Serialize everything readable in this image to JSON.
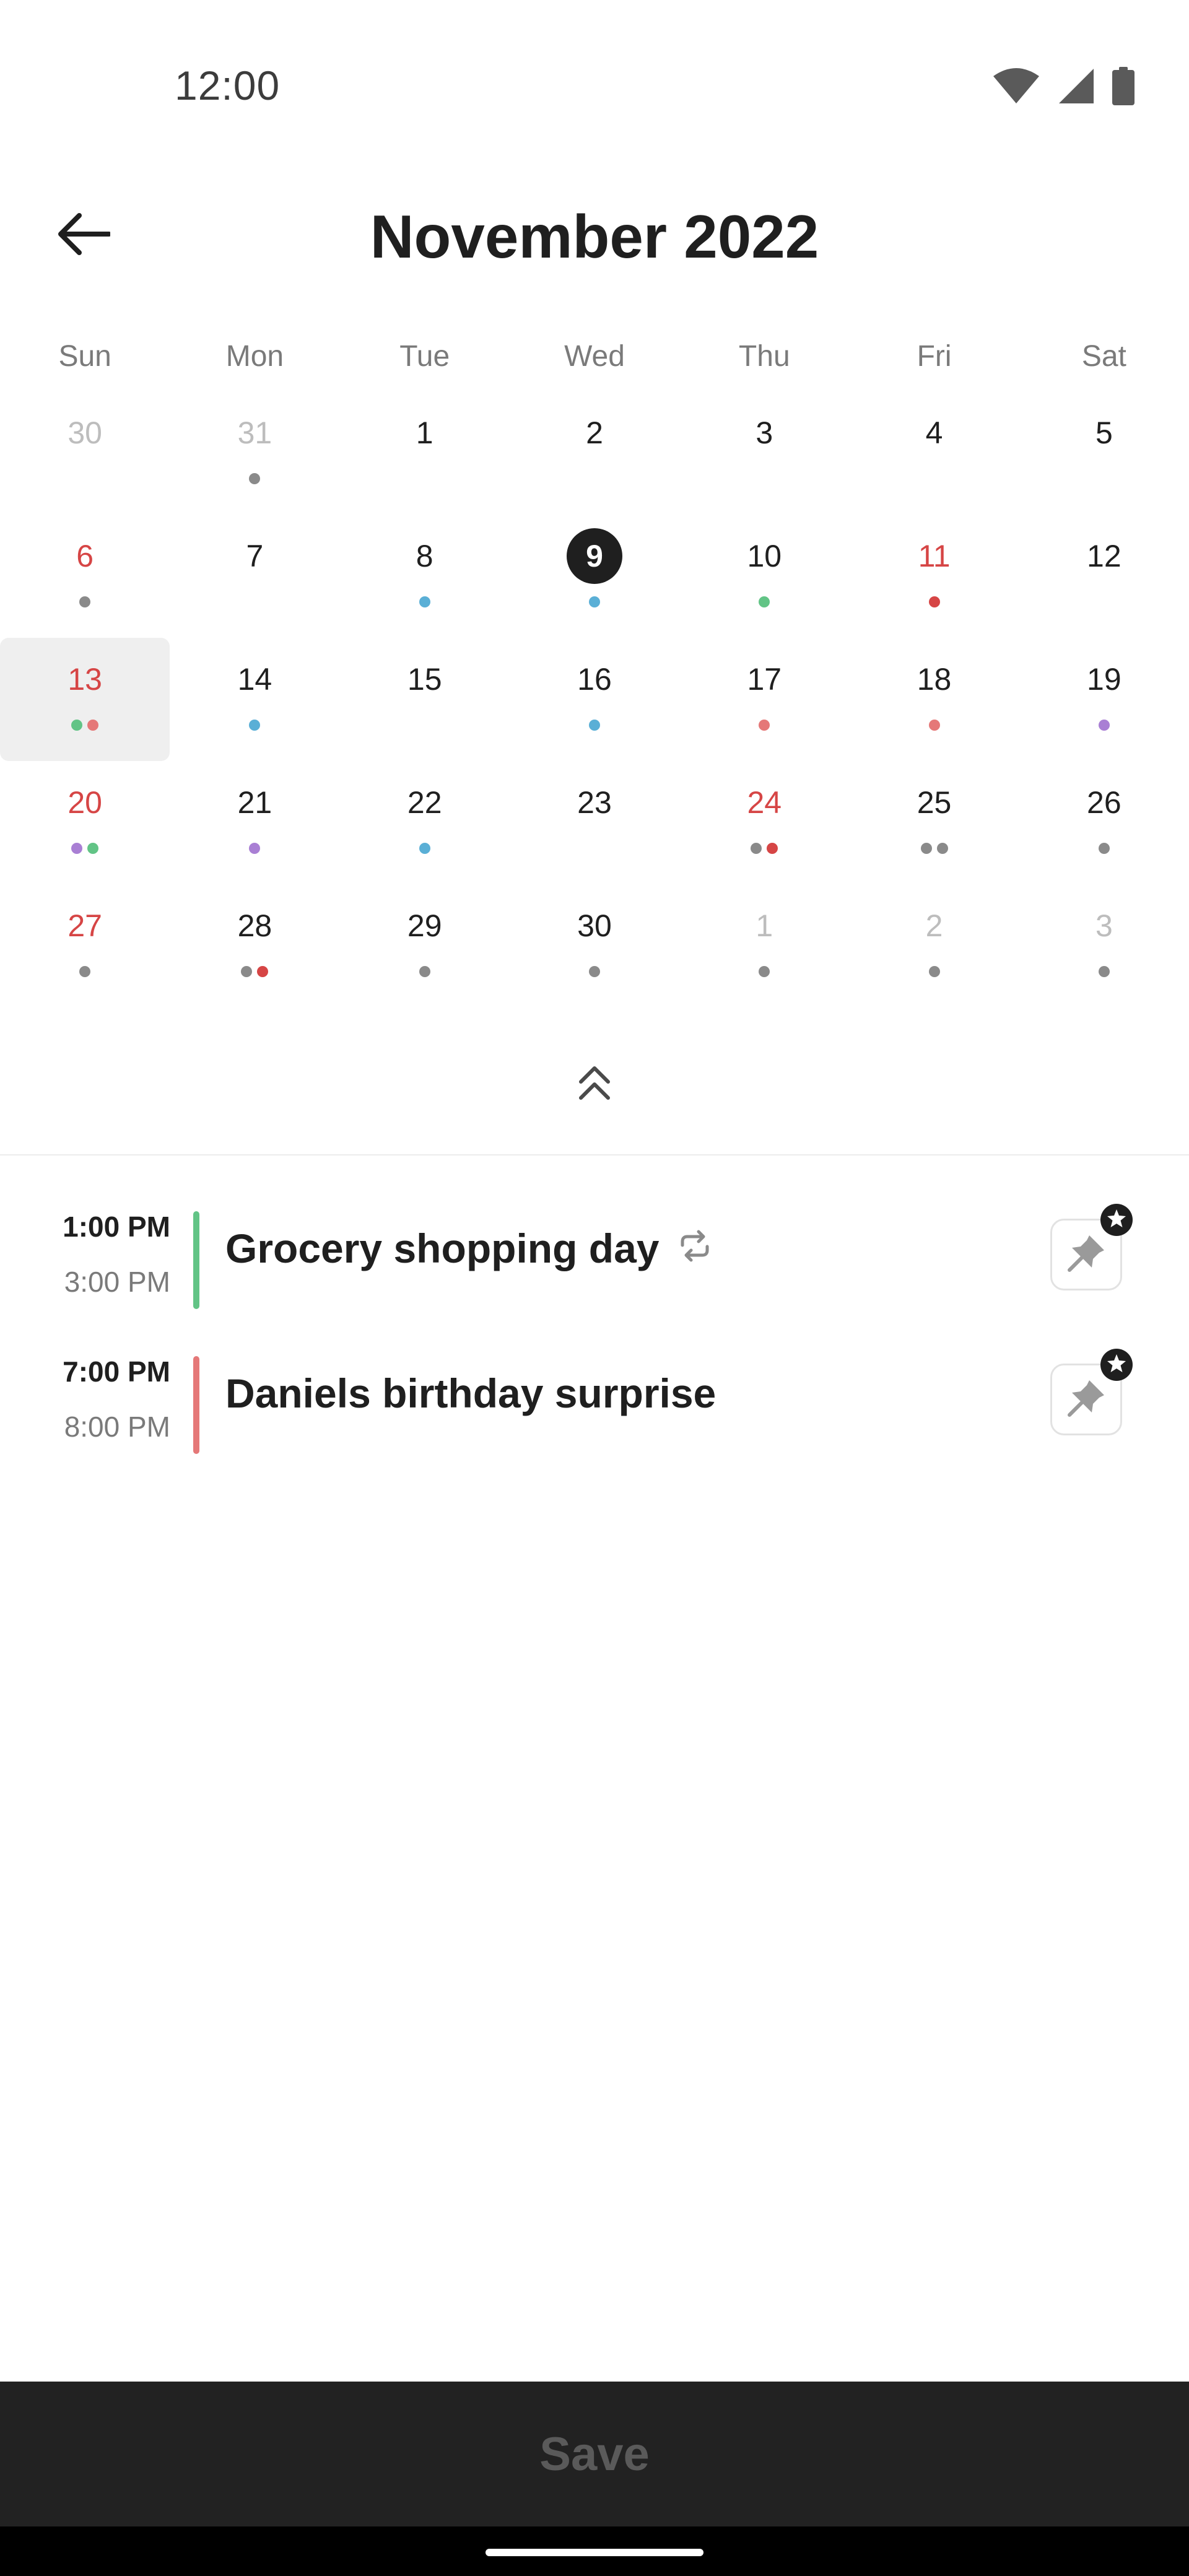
{
  "status_bar": {
    "time": "12:00",
    "icons": [
      "wifi-icon",
      "cellular-signal-icon",
      "battery-icon"
    ]
  },
  "header": {
    "title": "November 2022",
    "back_icon": "arrow-left-icon"
  },
  "calendar": {
    "weekdays": [
      "Sun",
      "Mon",
      "Tue",
      "Wed",
      "Thu",
      "Fri",
      "Sat"
    ],
    "days": [
      {
        "label": "30",
        "style": "muted",
        "dots": []
      },
      {
        "label": "31",
        "style": "muted",
        "dots": [
          "#8a8a8a"
        ]
      },
      {
        "label": "1",
        "style": "normal",
        "dots": []
      },
      {
        "label": "2",
        "style": "normal",
        "dots": []
      },
      {
        "label": "3",
        "style": "normal",
        "dots": []
      },
      {
        "label": "4",
        "style": "normal",
        "dots": []
      },
      {
        "label": "5",
        "style": "normal",
        "dots": []
      },
      {
        "label": "6",
        "style": "weekend",
        "dots": [
          "#8a8a8a"
        ]
      },
      {
        "label": "7",
        "style": "normal",
        "dots": []
      },
      {
        "label": "8",
        "style": "normal",
        "dots": [
          "#5aafd6"
        ]
      },
      {
        "label": "9",
        "style": "today",
        "dots": [
          "#5aafd6"
        ]
      },
      {
        "label": "10",
        "style": "normal",
        "dots": [
          "#62c486"
        ]
      },
      {
        "label": "11",
        "style": "weekend",
        "dots": [
          "#d64545"
        ]
      },
      {
        "label": "12",
        "style": "normal",
        "dots": []
      },
      {
        "label": "13",
        "style": "weekend",
        "highlighted": true,
        "dots": [
          "#62c486",
          "#e57878"
        ]
      },
      {
        "label": "14",
        "style": "normal",
        "dots": [
          "#5aafd6"
        ]
      },
      {
        "label": "15",
        "style": "normal",
        "dots": []
      },
      {
        "label": "16",
        "style": "normal",
        "dots": [
          "#5aafd6"
        ]
      },
      {
        "label": "17",
        "style": "normal",
        "dots": [
          "#e57878"
        ]
      },
      {
        "label": "18",
        "style": "normal",
        "dots": [
          "#e57878"
        ]
      },
      {
        "label": "19",
        "style": "normal",
        "dots": [
          "#a97fd4"
        ]
      },
      {
        "label": "20",
        "style": "weekend",
        "dots": [
          "#a97fd4",
          "#62c486"
        ]
      },
      {
        "label": "21",
        "style": "normal",
        "dots": [
          "#a97fd4"
        ]
      },
      {
        "label": "22",
        "style": "normal",
        "dots": [
          "#5aafd6"
        ]
      },
      {
        "label": "23",
        "style": "normal",
        "dots": []
      },
      {
        "label": "24",
        "style": "weekend",
        "dots": [
          "#8a8a8a",
          "#d64545"
        ]
      },
      {
        "label": "25",
        "style": "normal",
        "dots": [
          "#8a8a8a",
          "#8a8a8a"
        ]
      },
      {
        "label": "26",
        "style": "normal",
        "dots": [
          "#8a8a8a"
        ]
      },
      {
        "label": "27",
        "style": "weekend",
        "dots": [
          "#8a8a8a"
        ]
      },
      {
        "label": "28",
        "style": "normal",
        "dots": [
          "#8a8a8a",
          "#d64545"
        ]
      },
      {
        "label": "29",
        "style": "normal",
        "dots": [
          "#8a8a8a"
        ]
      },
      {
        "label": "30",
        "style": "normal",
        "dots": [
          "#8a8a8a"
        ]
      },
      {
        "label": "1",
        "style": "muted",
        "dots": [
          "#8a8a8a"
        ]
      },
      {
        "label": "2",
        "style": "muted",
        "dots": [
          "#8a8a8a"
        ]
      },
      {
        "label": "3",
        "style": "muted",
        "dots": [
          "#8a8a8a"
        ]
      }
    ],
    "collapse_icon": "double-chevron-up-icon"
  },
  "events": [
    {
      "start": "1:00 PM",
      "end": "3:00 PM",
      "title": "Grocery shopping day",
      "color": "#62c486",
      "repeat": true,
      "pin_icon": "pin-icon"
    },
    {
      "start": "7:00 PM",
      "end": "8:00 PM",
      "title": "Daniels birthday surprise",
      "color": "#e57878",
      "repeat": false,
      "pin_icon": "pin-icon"
    }
  ],
  "footer": {
    "save_label": "Save"
  }
}
